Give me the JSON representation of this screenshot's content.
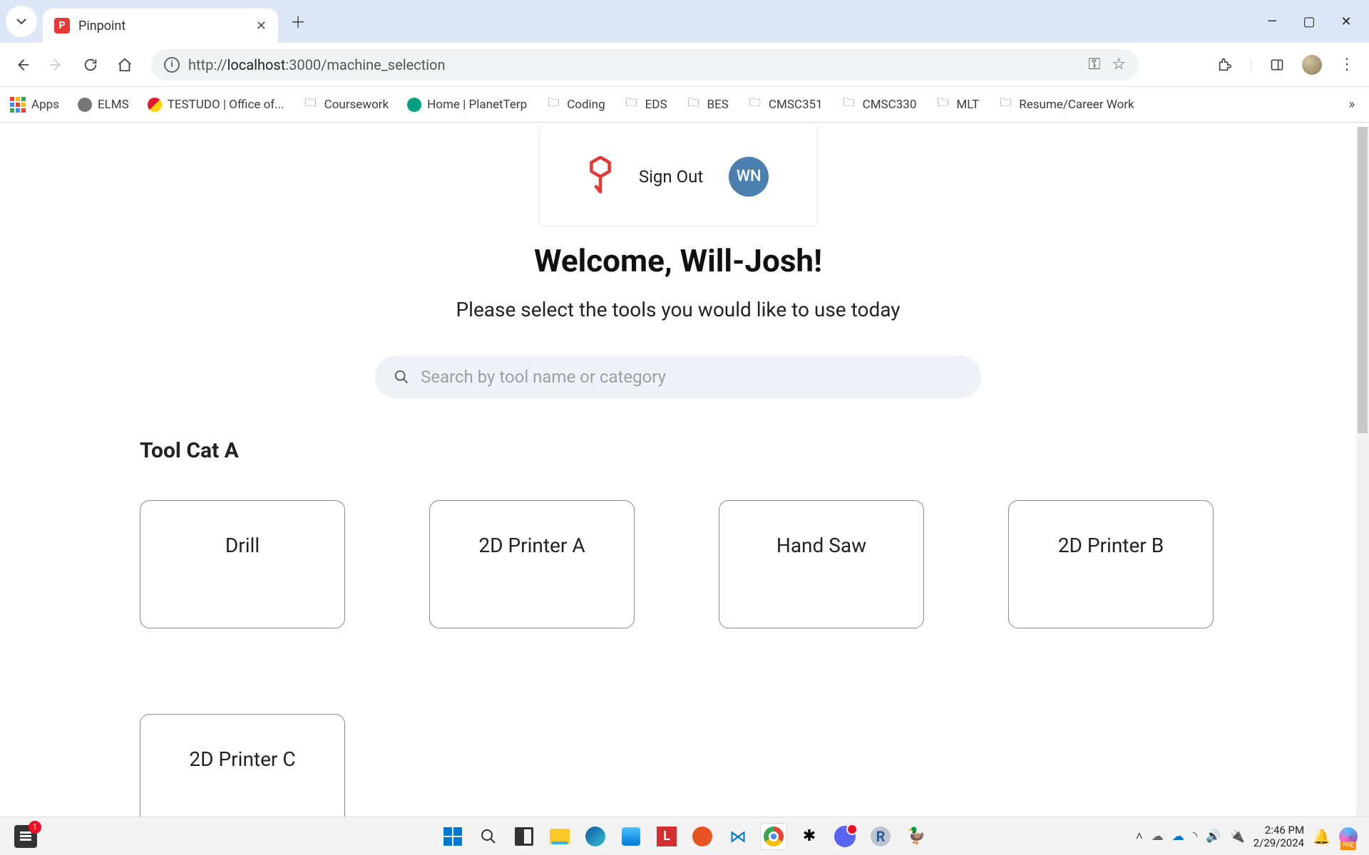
{
  "browser": {
    "tab_title": "Pinpoint",
    "url_prefix": "http://",
    "url_host": "localhost",
    "url_rest": ":3000/machine_selection"
  },
  "bookmarks": {
    "apps": "Apps",
    "items": [
      {
        "label": "ELMS",
        "icon": "globe"
      },
      {
        "label": "TESTUDO | Office of...",
        "icon": "testudo"
      },
      {
        "label": "Coursework",
        "icon": "folder"
      },
      {
        "label": "Home | PlanetTerp",
        "icon": "terp"
      },
      {
        "label": "Coding",
        "icon": "folder"
      },
      {
        "label": "EDS",
        "icon": "folder"
      },
      {
        "label": "BES",
        "icon": "folder"
      },
      {
        "label": "CMSC351",
        "icon": "folder"
      },
      {
        "label": "CMSC330",
        "icon": "folder"
      },
      {
        "label": "MLT",
        "icon": "folder"
      },
      {
        "label": "Resume/Career Work",
        "icon": "folder"
      }
    ]
  },
  "page": {
    "sign_out": "Sign Out",
    "avatar_initials": "WN",
    "welcome": "Welcome, Will-Josh!",
    "subtitle": "Please select the tools you would like to use today",
    "search_placeholder": "Search by tool name or category",
    "category_title": "Tool Cat A",
    "tools": [
      "Drill",
      "2D Printer A",
      "Hand Saw",
      "2D Printer B",
      "2D Printer C"
    ]
  },
  "taskbar": {
    "news_badge": "1",
    "time": "2:46 PM",
    "date": "2/29/2024",
    "copilot_tag": "PRE"
  }
}
